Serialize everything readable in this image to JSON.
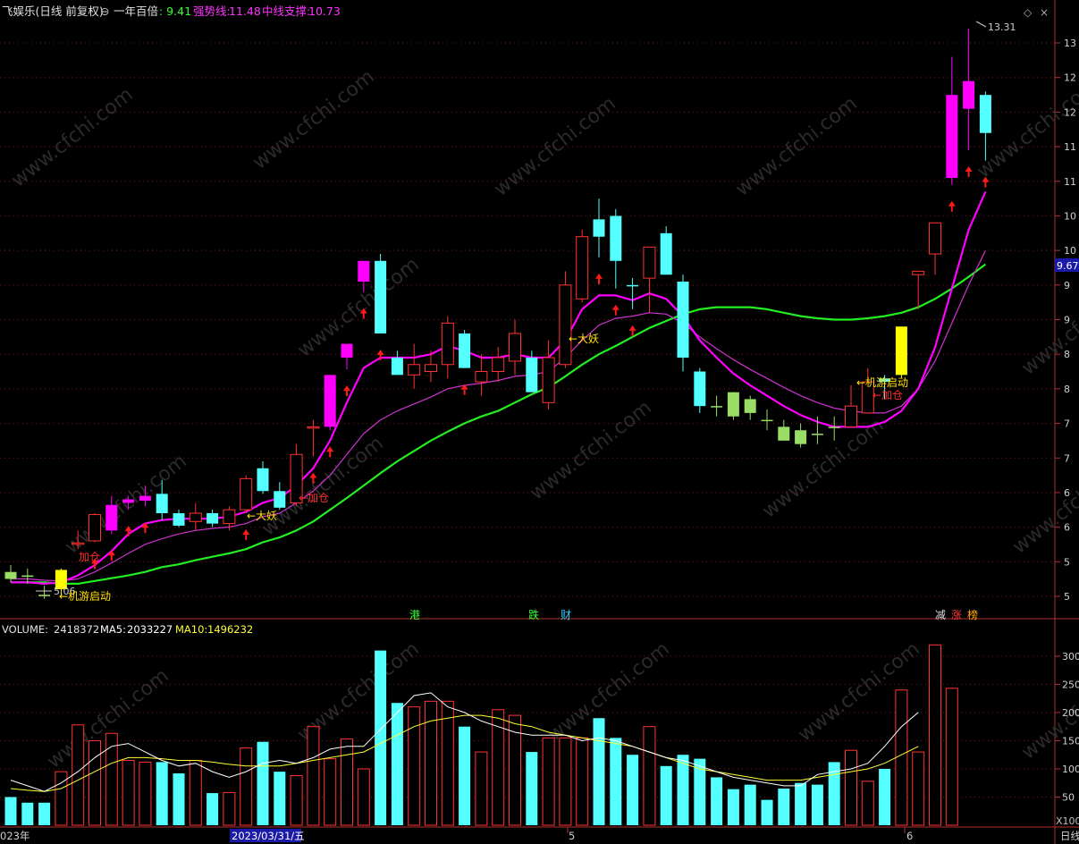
{
  "header": {
    "stock_name": "飞娱乐(日线 前复权)",
    "indicator_name": "一年百倍",
    "ind1_label": "强势线:",
    "ind1_value": "11.48",
    "ind2_label": "中线支撑:",
    "ind2_value": "10.73",
    "main_value": ": 9.41"
  },
  "price_axis": {
    "labels": [
      "13",
      "12",
      "12",
      "11",
      "11",
      "10",
      "10",
      "9",
      "9",
      "8",
      "8",
      "7",
      "7",
      "6",
      "6",
      "5",
      "5"
    ],
    "current_price_tag": "9.67",
    "high_marker": "13.31",
    "low_marker": "5.06"
  },
  "volume_header": {
    "volume_label": "VOLUME:",
    "volume_value": "2418372",
    "ma5_label": "MA5:",
    "ma5_value": "2033227",
    "ma10_label": "MA10:",
    "ma10_value": "1496232"
  },
  "volume_axis": {
    "labels": [
      "300",
      "250",
      "200",
      "150",
      "100",
      "50"
    ],
    "unit_label": "X100"
  },
  "date_axis": {
    "labels": [
      "023年",
      "2023/03/31/五",
      "5",
      "6",
      "日线"
    ]
  },
  "signals": [
    {
      "text": "加仓",
      "color": "#ff2a2a"
    },
    {
      "text": "←机游启动",
      "color": "#ffe000"
    },
    {
      "text": "←大妖",
      "color": "#ffe000"
    },
    {
      "text": "←加仓",
      "color": "#ff2a2a"
    },
    {
      "text": "←大妖",
      "color": "#ffe000"
    },
    {
      "text": "←机游启动",
      "color": "#ffe000"
    },
    {
      "text": "←加仓",
      "color": "#ff2a2a"
    }
  ],
  "event_markers": [
    {
      "text": "港",
      "color": "#33ff33"
    },
    {
      "text": "跌",
      "color": "#33ff33"
    },
    {
      "text": "财",
      "color": "#33ccff"
    },
    {
      "text": "减",
      "color": "#dddddd"
    },
    {
      "text": "涨",
      "color": "#ff3333"
    },
    {
      "text": "榜",
      "color": "#ffaa00"
    }
  ],
  "watermark": "www.cfchi.com",
  "colors": {
    "up": "#ff3333",
    "down": "#54ffff",
    "magenta": "#ff00ff",
    "yellow": "#ffff00",
    "green_candle": "#99dd66",
    "ma_strong": "#ff00ff",
    "ma_mid": "#cc33cc",
    "ma_support": "#22ee22",
    "vol_ma5": "#ffffff",
    "vol_ma10": "#ffff33"
  },
  "chart_data": {
    "type": "candlestick",
    "price_range": [
      4.8,
      13.4
    ],
    "volume_range": [
      0,
      330
    ],
    "candles": [
      {
        "o": 5.45,
        "h": 5.55,
        "l": 5.3,
        "c": 5.35,
        "s": "green"
      },
      {
        "o": 5.38,
        "h": 5.5,
        "l": 5.28,
        "c": 5.4,
        "s": "green"
      },
      {
        "o": 5.12,
        "h": 5.25,
        "l": 5.06,
        "c": 5.1,
        "s": "green"
      },
      {
        "o": 5.2,
        "h": 5.5,
        "l": 5.1,
        "c": 5.48,
        "s": "yellow"
      },
      {
        "o": 5.85,
        "h": 6.05,
        "l": 5.78,
        "c": 5.87,
        "s": "up"
      },
      {
        "o": 5.9,
        "h": 6.3,
        "l": 5.88,
        "c": 6.28,
        "s": "up"
      },
      {
        "o": 6.05,
        "h": 6.55,
        "l": 6.0,
        "c": 6.42,
        "s": "magenta"
      },
      {
        "o": 6.5,
        "h": 6.55,
        "l": 6.35,
        "c": 6.45,
        "s": "magenta"
      },
      {
        "o": 6.48,
        "h": 6.7,
        "l": 6.4,
        "c": 6.55,
        "s": "magenta"
      },
      {
        "o": 6.58,
        "h": 6.78,
        "l": 6.2,
        "c": 6.3,
        "s": "down"
      },
      {
        "o": 6.3,
        "h": 6.35,
        "l": 6.1,
        "c": 6.12,
        "s": "down"
      },
      {
        "o": 6.18,
        "h": 6.45,
        "l": 6.05,
        "c": 6.3,
        "s": "up"
      },
      {
        "o": 6.3,
        "h": 6.35,
        "l": 6.1,
        "c": 6.15,
        "s": "down"
      },
      {
        "o": 6.15,
        "h": 6.4,
        "l": 6.05,
        "c": 6.35,
        "s": "up"
      },
      {
        "o": 6.35,
        "h": 6.85,
        "l": 6.3,
        "c": 6.8,
        "s": "up"
      },
      {
        "o": 6.95,
        "h": 7.05,
        "l": 6.58,
        "c": 6.62,
        "s": "down"
      },
      {
        "o": 6.62,
        "h": 6.75,
        "l": 6.35,
        "c": 6.38,
        "s": "down"
      },
      {
        "o": 6.45,
        "h": 7.3,
        "l": 6.4,
        "c": 7.15,
        "s": "up"
      },
      {
        "o": 7.55,
        "h": 7.65,
        "l": 7.12,
        "c": 7.55,
        "s": "up"
      },
      {
        "o": 7.55,
        "h": 8.3,
        "l": 7.5,
        "c": 8.3,
        "s": "magenta"
      },
      {
        "o": 8.55,
        "h": 8.7,
        "l": 8.38,
        "c": 8.75,
        "s": "magenta"
      },
      {
        "o": 9.65,
        "h": 9.75,
        "l": 9.5,
        "c": 9.95,
        "s": "magenta"
      },
      {
        "o": 9.95,
        "h": 10.05,
        "l": 8.9,
        "c": 8.9,
        "s": "down"
      },
      {
        "o": 8.55,
        "h": 8.65,
        "l": 8.3,
        "c": 8.3,
        "s": "down"
      },
      {
        "o": 8.45,
        "h": 8.75,
        "l": 8.1,
        "c": 8.3,
        "s": "up"
      },
      {
        "o": 8.35,
        "h": 8.65,
        "l": 8.2,
        "c": 8.45,
        "s": "up"
      },
      {
        "o": 8.45,
        "h": 9.15,
        "l": 8.25,
        "c": 9.05,
        "s": "up"
      },
      {
        "o": 8.9,
        "h": 8.95,
        "l": 8.4,
        "c": 8.4,
        "s": "down"
      },
      {
        "o": 8.2,
        "h": 8.6,
        "l": 8.0,
        "c": 8.35,
        "s": "up"
      },
      {
        "o": 8.35,
        "h": 8.7,
        "l": 8.2,
        "c": 8.55,
        "s": "up"
      },
      {
        "o": 8.5,
        "h": 9.1,
        "l": 8.3,
        "c": 8.9,
        "s": "up"
      },
      {
        "o": 8.55,
        "h": 8.65,
        "l": 8.05,
        "c": 8.05,
        "s": "down"
      },
      {
        "o": 7.9,
        "h": 8.8,
        "l": 7.8,
        "c": 8.55,
        "s": "up"
      },
      {
        "o": 8.45,
        "h": 9.8,
        "l": 8.4,
        "c": 9.6,
        "s": "up"
      },
      {
        "o": 9.4,
        "h": 10.4,
        "l": 9.35,
        "c": 10.3,
        "s": "up"
      },
      {
        "o": 10.3,
        "h": 10.85,
        "l": 10.0,
        "c": 10.55,
        "s": "down"
      },
      {
        "o": 10.6,
        "h": 10.7,
        "l": 9.55,
        "c": 9.95,
        "s": "down"
      },
      {
        "o": 9.6,
        "h": 9.7,
        "l": 9.25,
        "c": 9.6,
        "s": "down"
      },
      {
        "o": 9.7,
        "h": 10.15,
        "l": 9.2,
        "c": 10.15,
        "s": "up"
      },
      {
        "o": 10.35,
        "h": 10.45,
        "l": 9.75,
        "c": 9.75,
        "s": "down"
      },
      {
        "o": 9.65,
        "h": 9.75,
        "l": 8.35,
        "c": 8.55,
        "s": "down"
      },
      {
        "o": 8.35,
        "h": 8.4,
        "l": 7.75,
        "c": 7.85,
        "s": "down"
      },
      {
        "o": 7.85,
        "h": 8.0,
        "l": 7.7,
        "c": 7.85,
        "s": "green"
      },
      {
        "o": 7.7,
        "h": 8.05,
        "l": 7.65,
        "c": 8.05,
        "s": "green"
      },
      {
        "o": 7.95,
        "h": 8.0,
        "l": 7.65,
        "c": 7.75,
        "s": "green"
      },
      {
        "o": 7.65,
        "h": 7.8,
        "l": 7.5,
        "c": 7.65,
        "s": "green"
      },
      {
        "o": 7.55,
        "h": 7.65,
        "l": 7.35,
        "c": 7.35,
        "s": "green"
      },
      {
        "o": 7.5,
        "h": 7.6,
        "l": 7.25,
        "c": 7.3,
        "s": "green"
      },
      {
        "o": 7.45,
        "h": 7.7,
        "l": 7.3,
        "c": 7.45,
        "s": "green"
      },
      {
        "o": 7.55,
        "h": 7.7,
        "l": 7.35,
        "c": 7.55,
        "s": "green"
      },
      {
        "o": 7.55,
        "h": 8.15,
        "l": 7.55,
        "c": 7.85,
        "s": "up"
      },
      {
        "o": 7.75,
        "h": 8.4,
        "l": 7.75,
        "c": 8.2,
        "s": "up"
      },
      {
        "o": 8.25,
        "h": 8.3,
        "l": 7.95,
        "c": 8.2,
        "s": "down"
      },
      {
        "o": 8.3,
        "h": 9.0,
        "l": 8.25,
        "c": 9.0,
        "s": "yellow"
      },
      {
        "o": 9.75,
        "h": 9.8,
        "l": 9.25,
        "c": 9.8,
        "s": "up"
      },
      {
        "o": 10.05,
        "h": 10.5,
        "l": 9.75,
        "c": 10.5,
        "s": "up"
      },
      {
        "o": 11.15,
        "h": 12.9,
        "l": 11.05,
        "c": 12.35,
        "s": "magenta"
      },
      {
        "o": 12.15,
        "h": 13.31,
        "l": 11.55,
        "c": 12.55,
        "s": "magenta"
      },
      {
        "o": 12.35,
        "h": 12.4,
        "l": 11.4,
        "c": 11.8,
        "s": "down"
      }
    ],
    "ma_strong": [
      5.3,
      5.3,
      5.28,
      5.3,
      5.4,
      5.55,
      5.75,
      6.0,
      6.15,
      6.2,
      6.22,
      6.22,
      6.22,
      6.25,
      6.32,
      6.45,
      6.52,
      6.7,
      6.95,
      7.35,
      7.9,
      8.4,
      8.55,
      8.55,
      8.55,
      8.6,
      8.72,
      8.65,
      8.55,
      8.55,
      8.6,
      8.55,
      8.55,
      8.8,
      9.25,
      9.45,
      9.45,
      9.38,
      9.48,
      9.4,
      9.15,
      8.8,
      8.55,
      8.32,
      8.15,
      8.0,
      7.85,
      7.72,
      7.62,
      7.55,
      7.55,
      7.55,
      7.62,
      7.78,
      8.1,
      8.7,
      9.55,
      10.4,
      10.95
    ],
    "ma_mid": [
      5.35,
      5.35,
      5.33,
      5.32,
      5.35,
      5.45,
      5.58,
      5.72,
      5.85,
      5.93,
      6.0,
      6.05,
      6.08,
      6.1,
      6.15,
      6.25,
      6.3,
      6.45,
      6.62,
      6.85,
      7.15,
      7.45,
      7.65,
      7.78,
      7.88,
      7.98,
      8.1,
      8.15,
      8.18,
      8.22,
      8.28,
      8.3,
      8.35,
      8.55,
      8.8,
      9.02,
      9.12,
      9.15,
      9.2,
      9.18,
      9.05,
      8.85,
      8.68,
      8.52,
      8.38,
      8.25,
      8.12,
      8.0,
      7.9,
      7.82,
      7.78,
      7.75,
      7.75,
      7.85,
      8.1,
      8.5,
      9.05,
      9.6,
      10.1
    ],
    "ma_support": [
      5.3,
      5.3,
      5.3,
      5.28,
      5.28,
      5.32,
      5.36,
      5.4,
      5.45,
      5.52,
      5.56,
      5.62,
      5.67,
      5.72,
      5.78,
      5.88,
      5.95,
      6.05,
      6.18,
      6.35,
      6.52,
      6.7,
      6.88,
      7.05,
      7.2,
      7.35,
      7.48,
      7.6,
      7.7,
      7.78,
      7.9,
      8.02,
      8.12,
      8.28,
      8.45,
      8.6,
      8.72,
      8.85,
      8.98,
      9.08,
      9.18,
      9.25,
      9.28,
      9.28,
      9.28,
      9.25,
      9.2,
      9.15,
      9.12,
      9.1,
      9.1,
      9.12,
      9.15,
      9.2,
      9.28,
      9.4,
      9.55,
      9.72,
      9.9
    ],
    "volume": [
      50,
      40,
      40,
      95,
      178,
      150,
      163,
      115,
      112,
      112,
      92,
      115,
      57,
      58,
      137,
      148,
      95,
      88,
      175,
      118,
      153,
      100,
      310,
      217,
      210,
      220,
      220,
      175,
      130,
      205,
      195,
      130,
      155,
      155,
      155,
      190,
      155,
      125,
      175,
      105,
      125,
      118,
      85,
      64,
      72,
      45,
      65,
      75,
      72,
      112,
      133,
      78,
      100,
      240,
      130,
      320,
      243
    ],
    "vol_ma5": [
      80,
      70,
      60,
      75,
      95,
      120,
      140,
      145,
      130,
      115,
      105,
      110,
      95,
      85,
      95,
      110,
      115,
      110,
      120,
      135,
      140,
      140,
      170,
      200,
      230,
      235,
      210,
      200,
      185,
      175,
      165,
      160,
      160,
      160,
      150,
      155,
      150,
      140,
      130,
      120,
      115,
      105,
      95,
      85,
      80,
      75,
      70,
      70,
      90,
      95,
      100,
      110,
      140,
      175,
      200
    ],
    "vol_ma10": [
      65,
      62,
      60,
      65,
      80,
      95,
      110,
      120,
      120,
      118,
      115,
      115,
      112,
      108,
      105,
      105,
      105,
      110,
      115,
      120,
      125,
      130,
      145,
      160,
      175,
      185,
      190,
      195,
      195,
      190,
      180,
      175,
      165,
      160,
      155,
      150,
      145,
      140,
      130,
      120,
      110,
      100,
      95,
      90,
      85,
      80,
      80,
      80,
      85,
      90,
      95,
      100,
      110,
      125,
      140
    ]
  }
}
